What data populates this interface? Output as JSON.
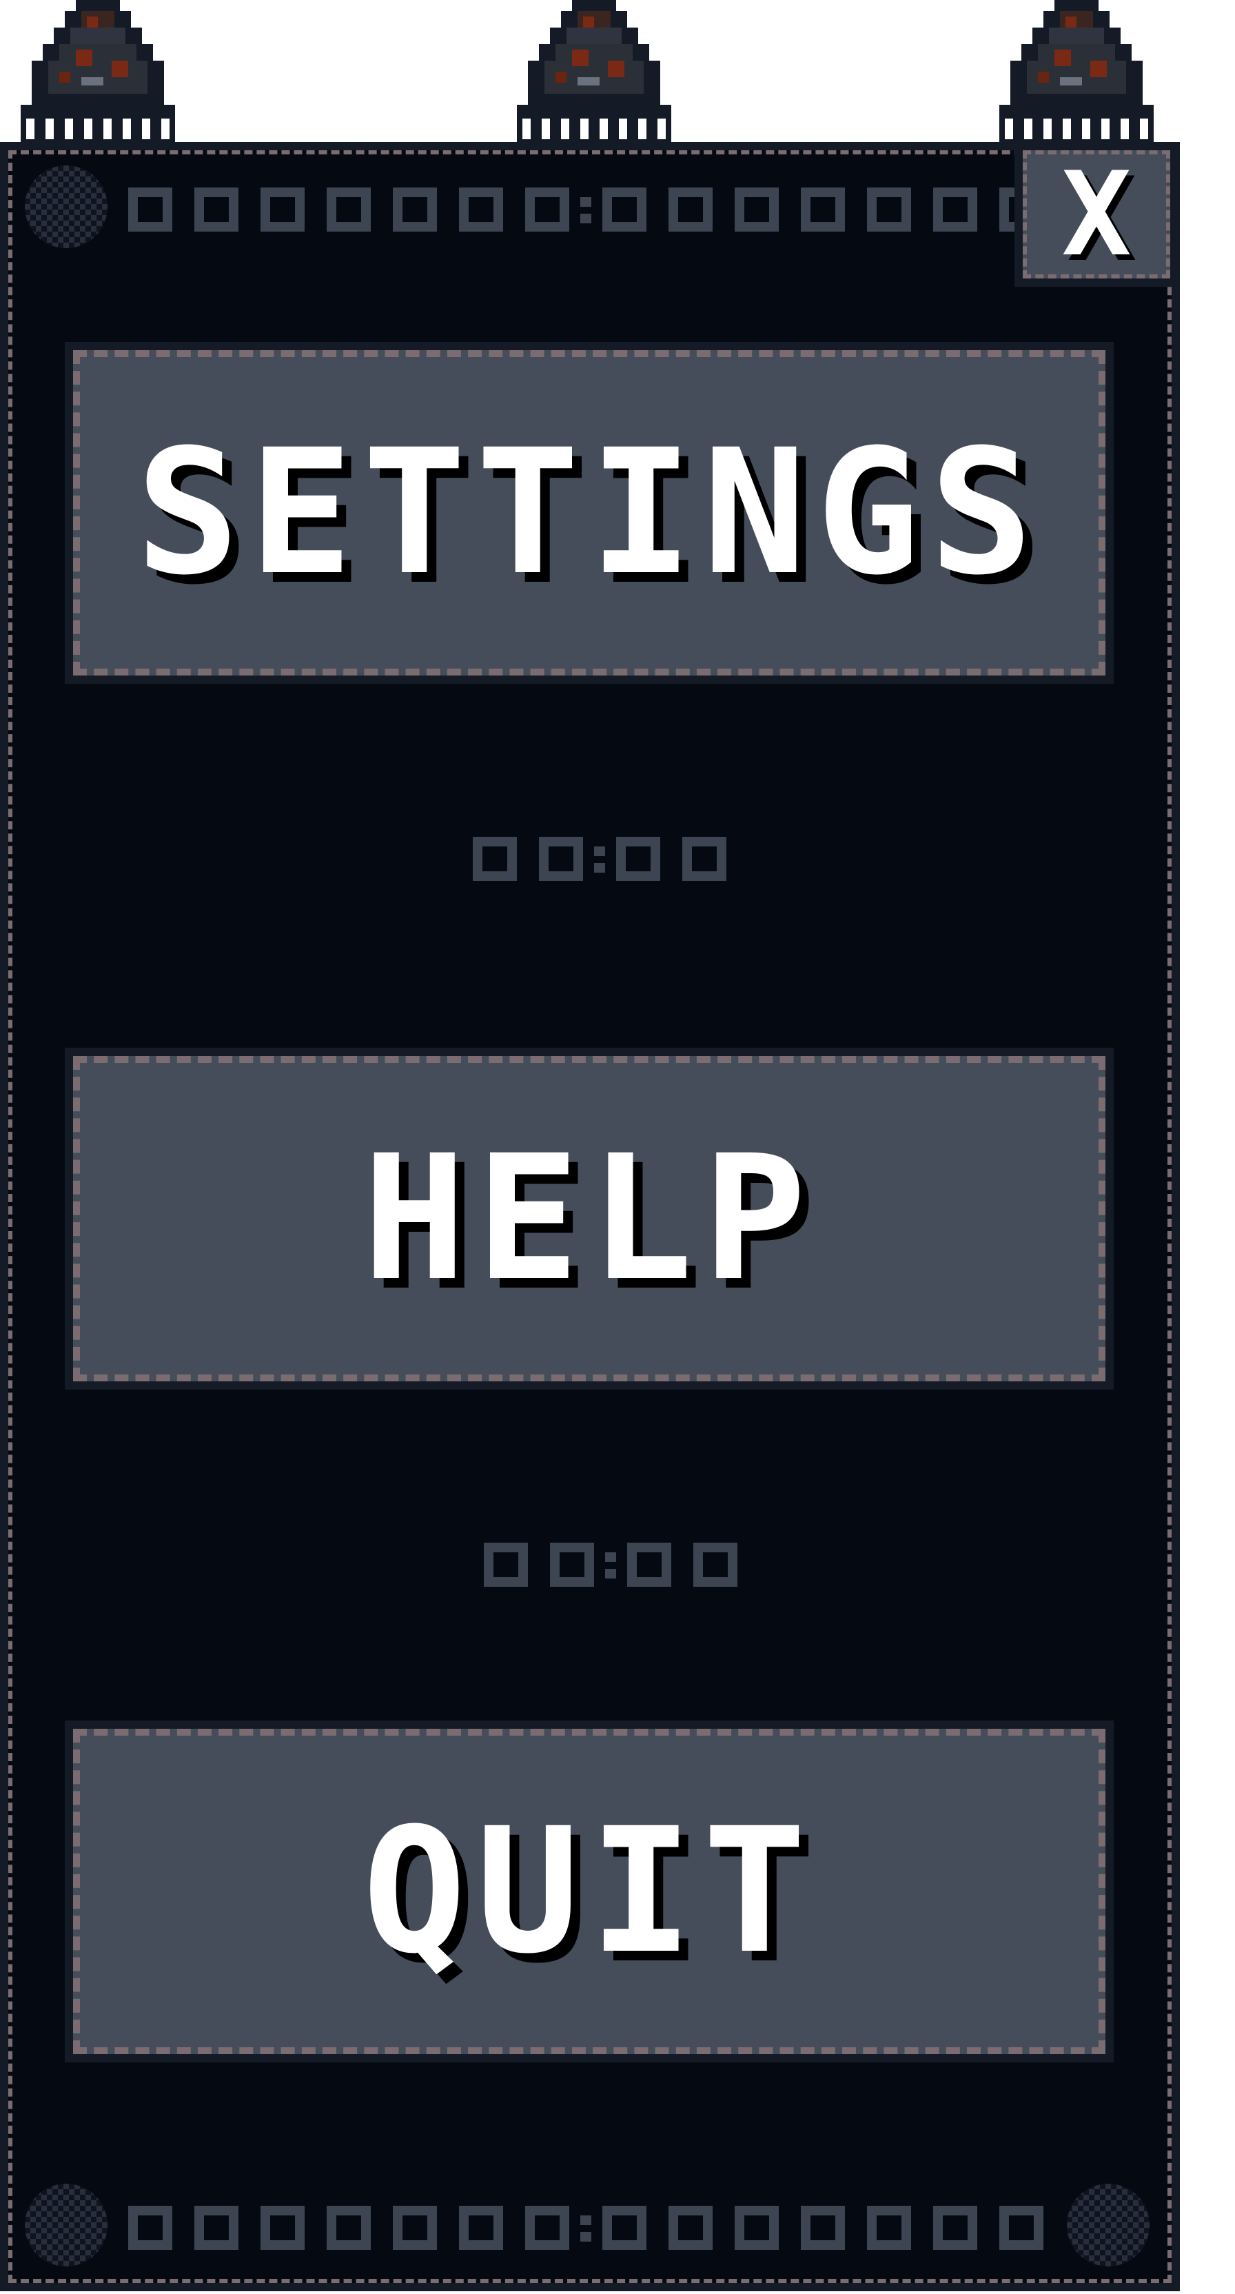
{
  "menu": {
    "close_label": "X",
    "buttons": [
      {
        "label": "SETTINGS"
      },
      {
        "label": "HELP"
      },
      {
        "label": "QUIT"
      }
    ]
  },
  "colors": {
    "panel_bg": "#050a12",
    "button_bg": "#454d5b",
    "dash_border": "#7a6c70",
    "text": "#ffffff"
  },
  "icons": {
    "lamp": "hanging-lamp-icon",
    "close": "close-icon",
    "corner": "corner-rivet-icon"
  }
}
